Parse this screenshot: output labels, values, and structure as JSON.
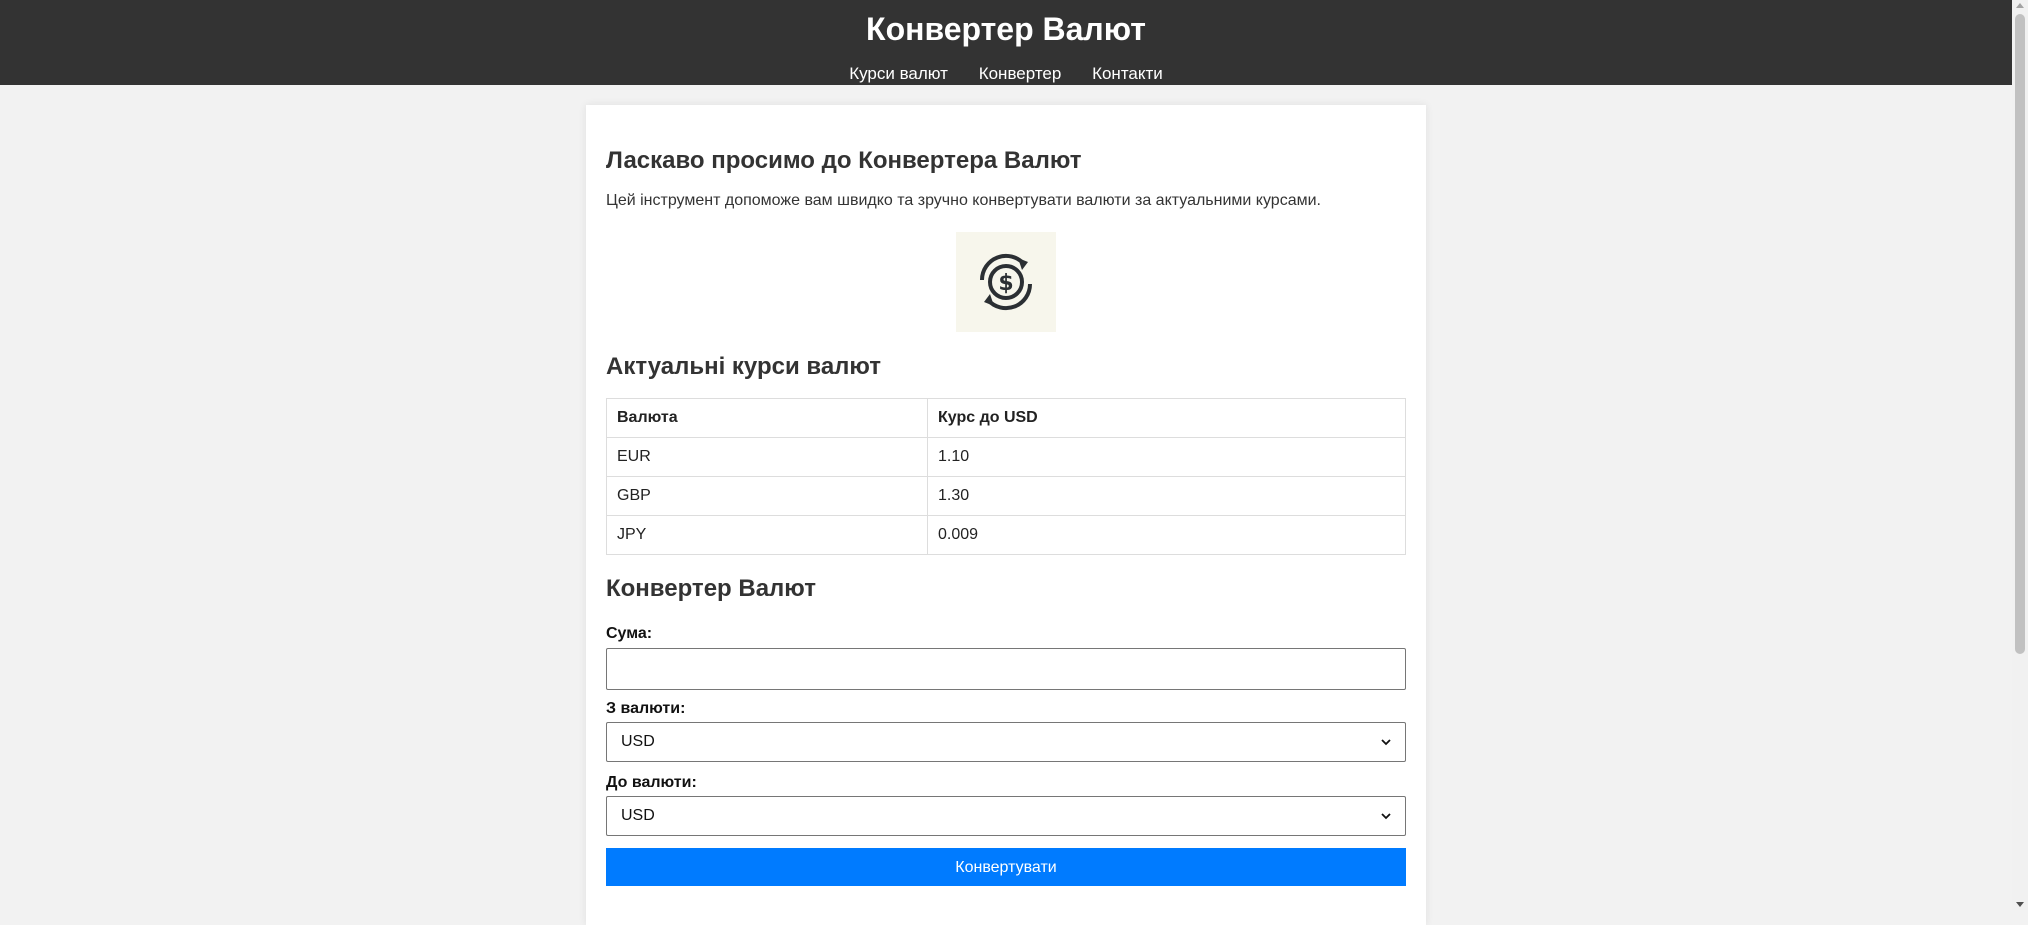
{
  "header": {
    "title": "Конвертер Валют",
    "nav": [
      "Курси валют",
      "Конвертер",
      "Контакти"
    ]
  },
  "welcome": {
    "title": "Ласкаво просимо до Конвертера Валют",
    "text": "Цей інструмент допоможе вам швидко та зручно конвертувати валюти за актуальними курсами.",
    "logo_icon": "currency-exchange-icon"
  },
  "rates": {
    "title": "Актуальні курси валют",
    "columns": [
      "Валюта",
      "Курс до USD"
    ],
    "rows": [
      [
        "EUR",
        "1.10"
      ],
      [
        "GBP",
        "1.30"
      ],
      [
        "JPY",
        "0.009"
      ]
    ]
  },
  "converter": {
    "title": "Конвертер Валют",
    "amount_label": "Сума:",
    "amount_value": "",
    "from_label": "З валюти:",
    "from_value": "USD",
    "to_label": "До валюти:",
    "to_value": "USD",
    "button_label": "Конвертувати"
  },
  "colors": {
    "header_bg": "#333333",
    "button_bg": "#007bff",
    "page_bg": "#f2f2f2"
  }
}
